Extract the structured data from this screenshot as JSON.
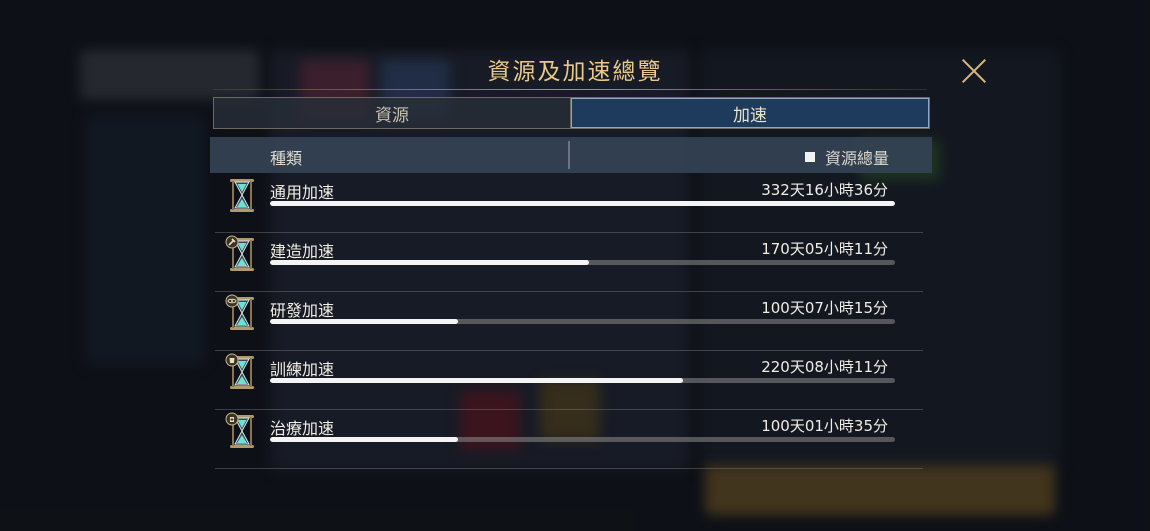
{
  "dialog": {
    "title": "資源及加速總覽",
    "close_icon": "close-x-icon"
  },
  "tabs": [
    {
      "label": "資源",
      "active": false
    },
    {
      "label": "加速",
      "active": true
    }
  ],
  "table": {
    "col_type": "種類",
    "col_total": "資源總量"
  },
  "speedups": [
    {
      "name": "通用加速",
      "value": "332天16小時36分",
      "fill": 1.0,
      "icon": "hourglass-icon"
    },
    {
      "name": "建造加速",
      "value": "170天05小時11分",
      "fill": 0.51,
      "icon": "hourglass-hammer-icon"
    },
    {
      "name": "研發加速",
      "value": "100天07小時15分",
      "fill": 0.3,
      "icon": "hourglass-research-icon"
    },
    {
      "name": "訓練加速",
      "value": "220天08小時11分",
      "fill": 0.66,
      "icon": "hourglass-training-icon"
    },
    {
      "name": "治療加速",
      "value": "100天01小時35分",
      "fill": 0.3,
      "icon": "hourglass-healing-icon"
    }
  ],
  "colors": {
    "title": "#e8c98a",
    "active_tab": "#1e3a5c",
    "bar_fill": "#f4f4f4"
  }
}
